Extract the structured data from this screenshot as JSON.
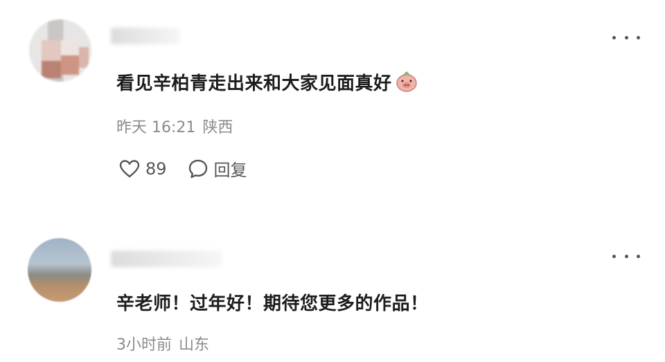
{
  "comments": [
    {
      "text": "看见辛柏青走出来和大家见面真好",
      "time": "昨天 16:21",
      "location": "陕西",
      "likes": "89",
      "reply_label": "回复"
    },
    {
      "text": "辛老师！过年好！期待您更多的作品！",
      "time": "3小时前",
      "location": "山东"
    }
  ],
  "icons": {
    "more": "more-dots-icon",
    "like": "heart-icon",
    "reply": "speech-bubble-icon",
    "emoji": "pig-face-emoji-icon"
  },
  "colors": {
    "text": "#1c1c1c",
    "meta": "#8a8a8a"
  }
}
